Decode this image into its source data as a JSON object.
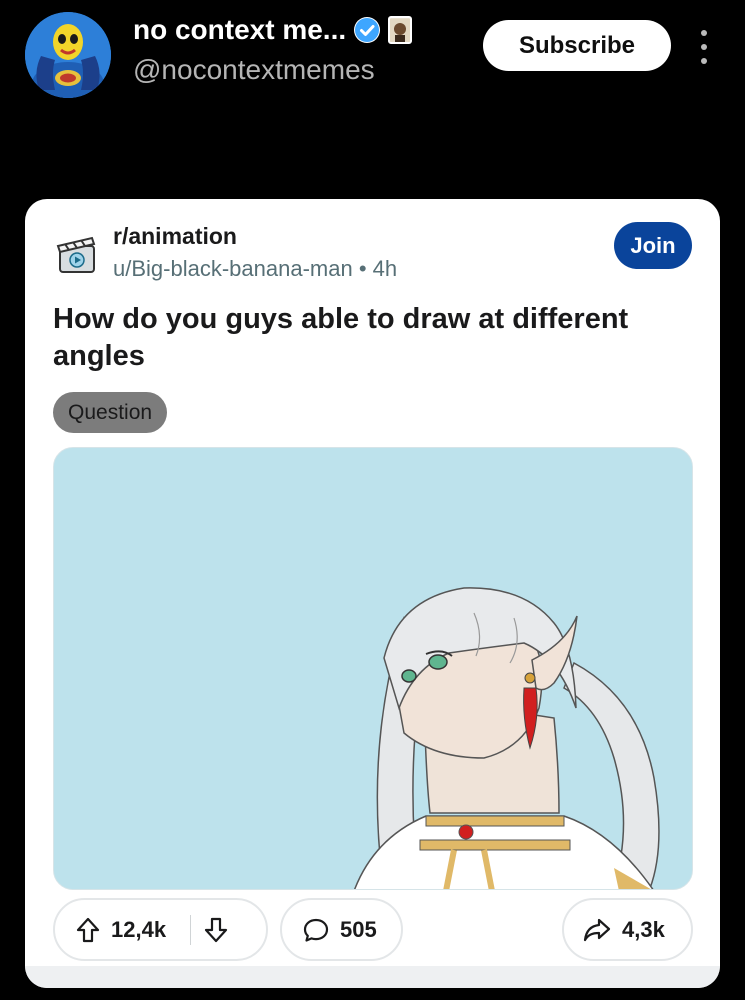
{
  "channel": {
    "name": "no context me...",
    "handle": "@nocontextmemes",
    "subscribe_label": "Subscribe"
  },
  "post": {
    "subreddit": "r/animation",
    "author": "u/Big-black-banana-man",
    "separator": "•",
    "age": "4h",
    "join_label": "Join",
    "title": "How do you guys able to draw at different angles",
    "flair": "Question"
  },
  "actions": {
    "upvotes": "12,4k",
    "comments": "505",
    "shares": "4,3k"
  },
  "colors": {
    "background": "#000000",
    "card": "#ffffff",
    "join_button": "#0a449b",
    "flair": "#7c7c7c",
    "media_background": "#bde2ec",
    "verified": "#3ea6ff"
  },
  "icons": [
    "verified-icon",
    "upvote-icon",
    "downvote-icon",
    "comment-icon",
    "share-icon",
    "more-options-icon"
  ]
}
